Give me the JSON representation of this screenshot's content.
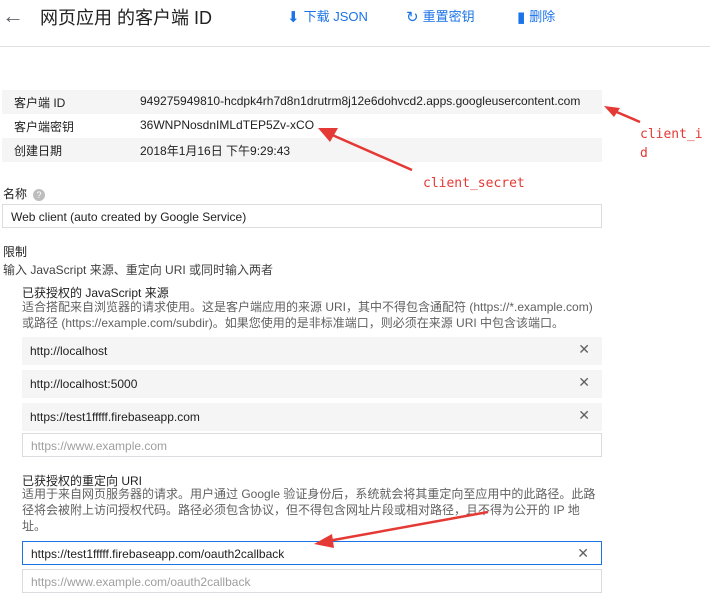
{
  "header": {
    "back_icon": "arrow-left-icon",
    "title": "网页应用 的客户端 ID",
    "download_label": "下载 JSON",
    "reset_label": "重置密钥",
    "delete_label": "删除",
    "accent": "#1a73e8"
  },
  "info": {
    "client_id_label": "客户端 ID",
    "client_id_value": "949275949810-hcdpk4rh7d8n1drutrm8j12e6dohvcd2.apps.googleusercontent.com",
    "client_secret_label": "客户端密钥",
    "client_secret_value": "36WNPNosdnIMLdTEP5Zv-xCO",
    "created_label": "创建日期",
    "created_value": "2018年1月16日 下午9:29:43"
  },
  "name": {
    "label": "名称",
    "value": "Web client  (auto created by Google Service)"
  },
  "restrictions": {
    "heading": "限制",
    "subtitle": "输入 JavaScript 来源、重定向 URI 或同时输入两者"
  },
  "js_origins": {
    "title": "已获授权的 JavaScript 来源",
    "desc1": "适合搭配来自浏览器的请求使用。这是客户端应用的来源 URI，其中不得包含通配符 (https://*.example.com)",
    "desc2": "或路径 (https://example.com/subdir)。如果您使用的是非标准端口，则必须在来源 URI 中包含该端口。",
    "items": [
      "http://localhost",
      "http://localhost:5000",
      "https://test1fffff.firebaseapp.com"
    ],
    "placeholder": "https://www.example.com"
  },
  "redirect_uris": {
    "title": "已获授权的重定向 URI",
    "desc1": "适用于来自网页服务器的请求。用户通过 Google 验证身份后，系统就会将其重定向至应用中的此路径。此路",
    "desc2": "径将会被附上访问授权代码。路径必须包含协议，但不得包含网址片段或相对路径，且不得为公开的 IP 地",
    "desc3": "址。",
    "value": "https://test1fffff.firebaseapp.com/oauth2callback",
    "placeholder": "https://www.example.com/oauth2callback"
  },
  "annotations": {
    "client_id_a": "client_i",
    "client_id_b": "d",
    "client_secret": "client_secret",
    "color": "#e53935"
  }
}
